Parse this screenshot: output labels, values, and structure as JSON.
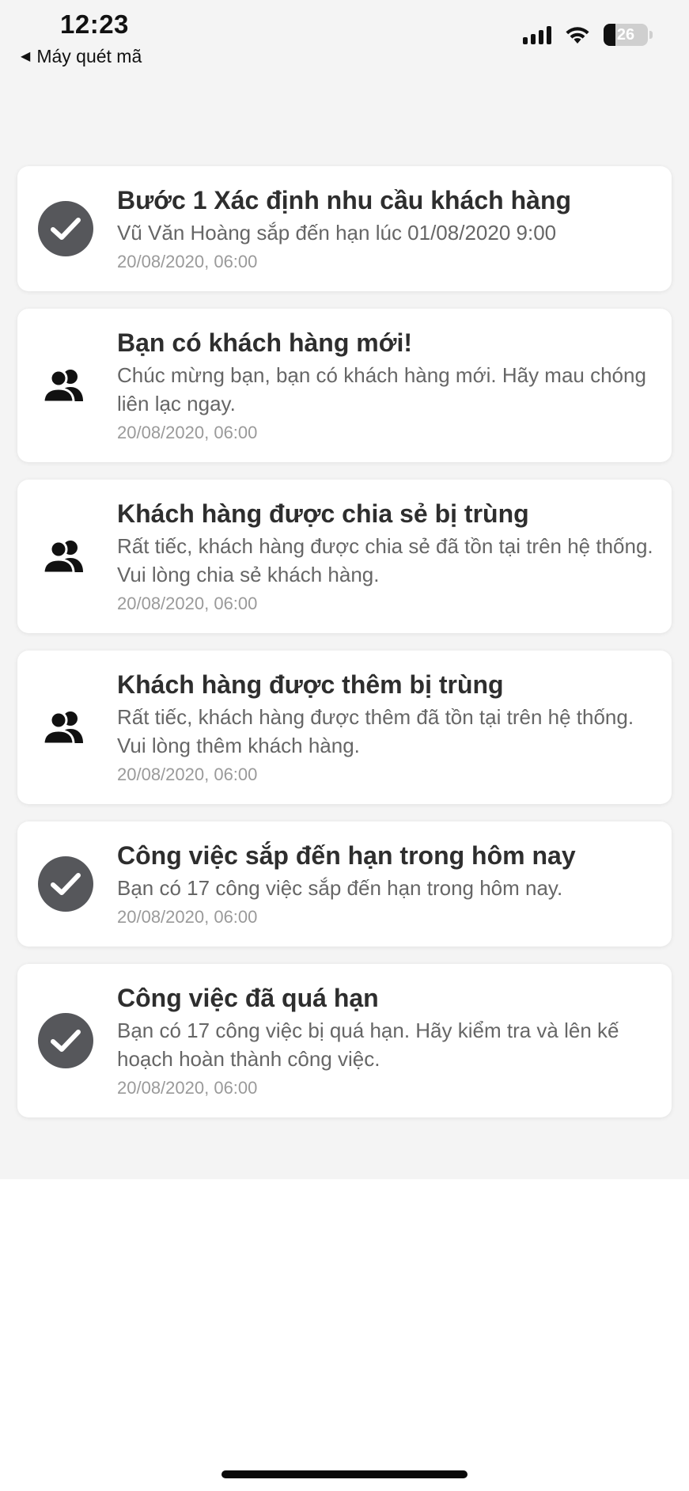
{
  "status_bar": {
    "time": "12:23",
    "back_app": "Máy quét mã",
    "battery_level": 26,
    "battery_text": "26"
  },
  "notifications": [
    {
      "icon": "check-circle-icon",
      "title": "Bước 1 Xác định nhu cầu khách hàng",
      "body": "Vũ Văn Hoàng sắp đến hạn lúc 01/08/2020 9:00",
      "date": "20/08/2020, 06:00"
    },
    {
      "icon": "users-icon",
      "title": "Bạn có khách hàng mới!",
      "body": "Chúc mừng bạn, bạn có khách hàng mới. Hãy mau chóng liên lạc ngay.",
      "date": "20/08/2020, 06:00"
    },
    {
      "icon": "users-icon",
      "title": "Khách hàng được chia sẻ bị trùng",
      "body": "Rất tiếc, khách hàng được chia sẻ đã tồn tại trên hệ thống. Vui lòng chia sẻ khách hàng.",
      "date": "20/08/2020, 06:00"
    },
    {
      "icon": "users-icon",
      "title": "Khách hàng được thêm bị trùng",
      "body": "Rất tiếc, khách hàng được thêm đã tồn tại trên hệ thống. Vui lòng thêm khách hàng.",
      "date": "20/08/2020, 06:00"
    },
    {
      "icon": "check-circle-icon",
      "title": "Công việc sắp đến hạn trong hôm nay",
      "body": "Bạn có 17 công việc sắp đến hạn trong hôm nay.",
      "date": "20/08/2020, 06:00"
    },
    {
      "icon": "check-circle-icon",
      "title": "Công việc đã quá hạn",
      "body": "Bạn có 17 công việc bị quá hạn. Hãy kiểm tra và lên kế hoạch hoàn thành công việc.",
      "date": "20/08/2020, 06:00"
    }
  ]
}
